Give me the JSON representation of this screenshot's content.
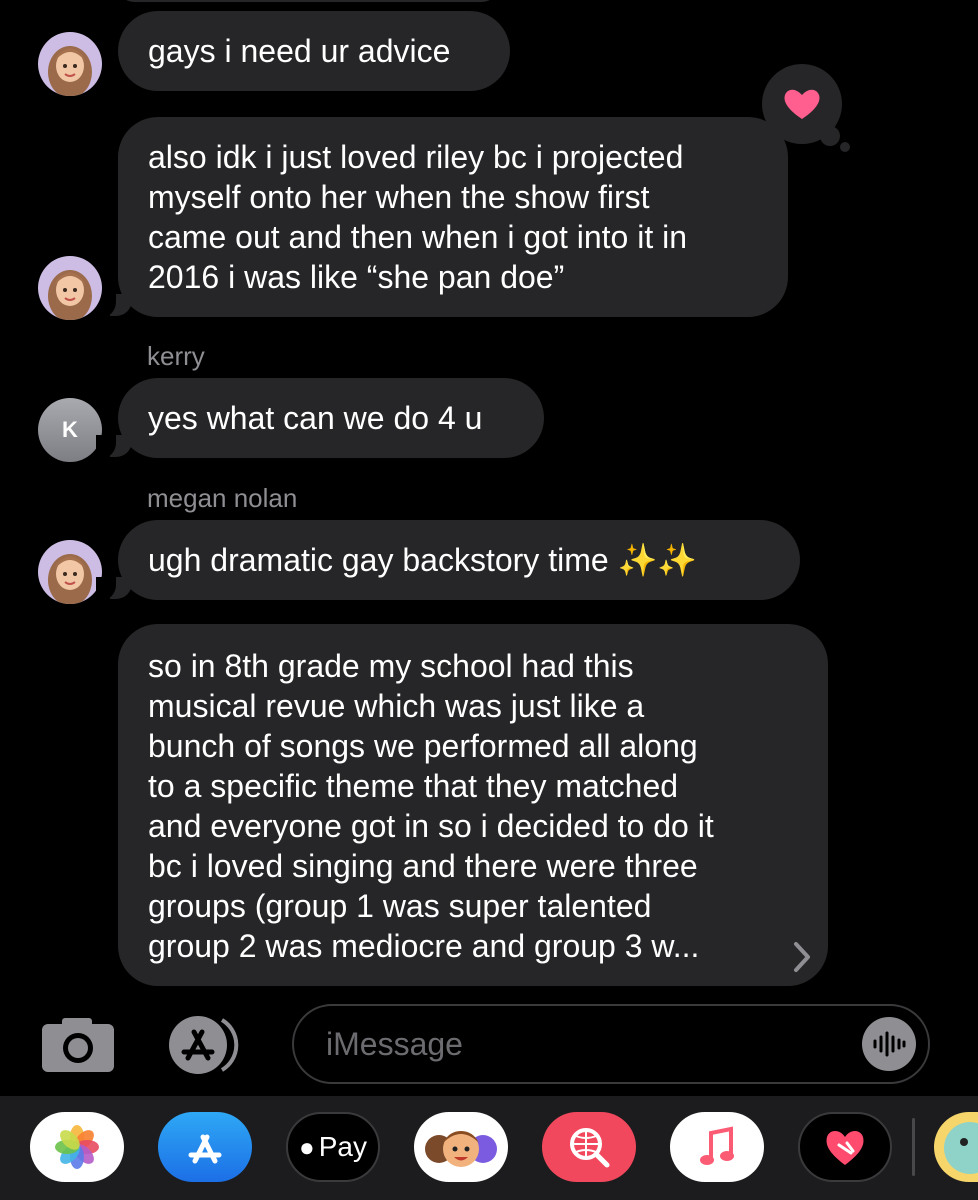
{
  "messages": [
    {
      "lines": [
        "gays i need ur advice"
      ]
    },
    {
      "lines": [
        "also idk i just loved riley bc i projected",
        "myself onto her when the show first",
        "came out and then when i got into it in",
        "2016 i was like “she pan doe”"
      ]
    },
    {
      "sender": "kerry",
      "avatar_initial": "K",
      "lines": [
        "yes what can we do 4 u"
      ]
    },
    {
      "sender": "megan nolan",
      "lines": [
        "ugh dramatic gay backstory time ✨✨"
      ]
    },
    {
      "lines": [
        "so in 8th grade my school had this",
        "musical revue which was just like a",
        "bunch of songs we performed all along",
        "to a specific theme that they matched",
        "and everyone got in so i decided to do it",
        "bc i loved singing and there were three",
        "groups (group 1 was super talented",
        "group 2 was mediocre and group 3 w..."
      ]
    }
  ],
  "reaction": "heart",
  "input": {
    "placeholder": "iMessage"
  },
  "dock": {
    "apple_pay_label": "Pay"
  },
  "colors": {
    "bubble": "#262628",
    "background": "#000000",
    "heart": "#ff5f8f"
  }
}
